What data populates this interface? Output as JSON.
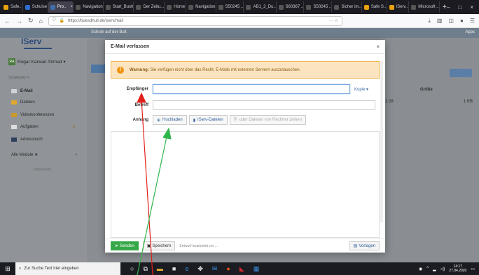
{
  "browser": {
    "tabs": [
      {
        "label": "Safe..",
        "color": "#e8a20c",
        "active": false
      },
      {
        "label": "Schulse",
        "color": "#2f6fd1",
        "active": false
      },
      {
        "label": "Pro..",
        "color": "#3f6ea8",
        "active": true
      },
      {
        "label": "Navigation",
        "color": "#555555",
        "active": false
      },
      {
        "label": "Start_Bush",
        "color": "#555555",
        "active": false
      },
      {
        "label": "Der Zeitu...",
        "color": "#555555",
        "active": false
      },
      {
        "label": "Home",
        "color": "#555555",
        "active": false
      },
      {
        "label": "Navigation",
        "color": "#555555",
        "active": false
      },
      {
        "label": "S50245 ..",
        "color": "#555555",
        "active": false
      },
      {
        "label": "AB1_2_Du..",
        "color": "#555555",
        "active": false
      },
      {
        "label": "S60367 ..",
        "color": "#555555",
        "active": false
      },
      {
        "label": "S50245 ..",
        "color": "#555555",
        "active": false
      },
      {
        "label": "Sicher im..",
        "color": "#555555",
        "active": false
      },
      {
        "label": "Safe S..",
        "color": "#e8a20c",
        "active": false
      },
      {
        "label": "iServ..",
        "color": "#e8a20c",
        "active": false
      },
      {
        "label": "Microsoft ..",
        "color": "#555555",
        "active": false
      }
    ],
    "url": "https://buesdhull.de/iserv/mail",
    "new_tab": "+"
  },
  "page": {
    "top_title": "Schule auf der Bult",
    "top_right": "Apps",
    "logo": "IServ",
    "user": {
      "initials": "RA",
      "name": "Rogar Karwan Ahmad ▾"
    },
    "user_sub": "Schulkonto ✎",
    "sidebar": [
      {
        "label": "E-Mail",
        "icon": "mail-icon",
        "color": "#cfd4da"
      },
      {
        "label": "Dateien",
        "icon": "folder-icon",
        "color": "#e0a82e"
      },
      {
        "label": "Videokonferenzen",
        "icon": "video-icon",
        "color": "#c89a2a"
      },
      {
        "label": "Aufgaben",
        "icon": "tasks-icon",
        "color": "#dddddd",
        "badge": "1"
      },
      {
        "label": "Adressbuch",
        "icon": "addressbook-icon",
        "color": "#2e3f5a"
      },
      {
        "label": "Alle Module ★",
        "icon": "",
        "color": "",
        "arrow": "›"
      }
    ],
    "sidebar_foot": "Impressum",
    "right": {
      "col_header": "Größe",
      "value_left": "1:28",
      "value_right": "1 KB"
    }
  },
  "modal": {
    "title": "E-Mail verfassen",
    "close": "×",
    "warning": {
      "strong": "Warnung:",
      "text": "Sie verfügen nicht über das Recht, E-Mails mit externen Servern auszutauschen."
    },
    "recipient_label": "Empfänger",
    "recipient_value": "",
    "copy_label": "Kopie ▾",
    "subject_label": "Betreff",
    "attachment_label": "Anhang",
    "upload_label": "Hochladen",
    "iserv_files_label": "IServ-Dateien",
    "pc_files_label": "oder Dateien von Rechner ziehen",
    "send_label": "Senden",
    "save_label": "Speichern",
    "meta": "Entwurf bearbeitet vor ...",
    "template_label": "Vorlagen"
  },
  "taskbar": {
    "search_placeholder": "Zur Suche Text hier eingeben",
    "time": "14:17",
    "date": "27.04.2020"
  },
  "colors": {
    "red_arrow": "#e0201c",
    "green_arrow": "#2fb54a",
    "warning_bg": "#fbe4bf",
    "send_green": "#37a848"
  }
}
